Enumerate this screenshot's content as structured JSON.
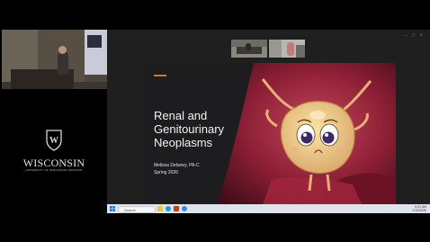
{
  "branding": {
    "wordmark": "WISCONSIN",
    "subline": "UNIVERSITY OF WISCONSIN–MADISON",
    "crest_letter": "W"
  },
  "slide": {
    "title_lines": [
      "Renal and",
      "Genitourinary",
      "Neoplasms"
    ],
    "author": "Melissa Delaney, PA-C",
    "term": "Spring 2026",
    "accent_color": "#e0703a"
  },
  "taskbar": {
    "search_label": "Search",
    "clock_time": "9:21 AM",
    "clock_date": "1/13/2026"
  },
  "icons": {
    "window_controls": "window-controls-icon",
    "start": "windows-start-icon"
  }
}
